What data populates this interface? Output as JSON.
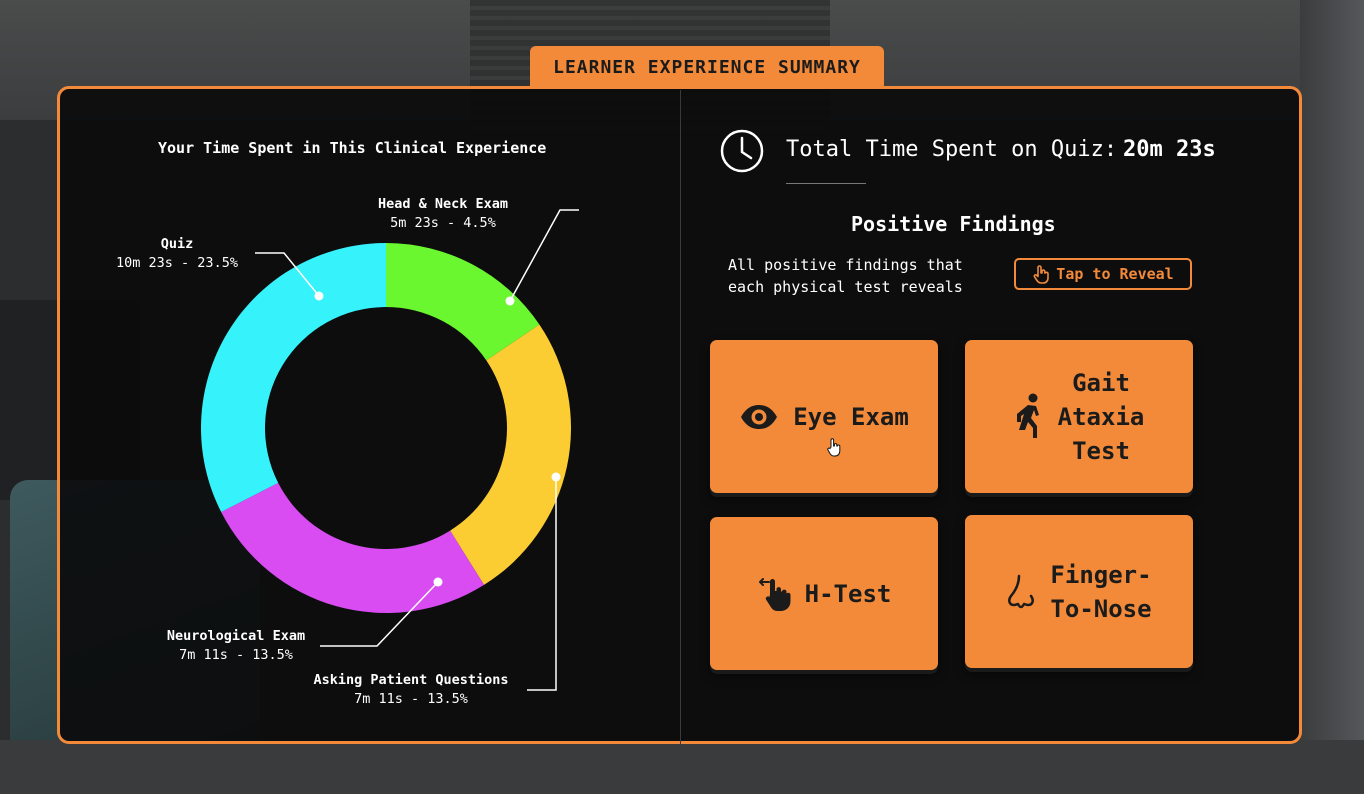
{
  "header": {
    "title": "LEARNER EXPERIENCE SUMMARY"
  },
  "time_chart": {
    "title": "Your Time Spent in This Clinical Experience",
    "segments": [
      {
        "name": "Head & Neck Exam",
        "value": "5m 23s - 4.5%",
        "color": "#6af72f"
      },
      {
        "name": "Asking Patient Questions",
        "value": "7m 11s - 13.5%",
        "color": "#fbcd33"
      },
      {
        "name": "Neurological Exam",
        "value": "7m 11s - 13.5%",
        "color": "#d84cf2"
      },
      {
        "name": "Quiz",
        "value": "10m 23s - 23.5%",
        "color": "#35f2fb"
      }
    ]
  },
  "total": {
    "label": "Total Time Spent on Quiz:",
    "value": "20m 23s",
    "icon": "clock-icon"
  },
  "findings": {
    "title": "Positive Findings",
    "description": "All positive findings that each physical test reveals",
    "reveal_button": "Tap to Reveal",
    "tests": [
      {
        "label": "Eye Exam",
        "icon": "eye-icon"
      },
      {
        "label": "Gait\nAtaxia\nTest",
        "icon": "walking-person-icon"
      },
      {
        "label": "H-Test",
        "icon": "hand-swipe-icon"
      },
      {
        "label": "Finger-\nTo-Nose",
        "icon": "nose-icon"
      }
    ]
  },
  "colors": {
    "accent": "#f28a3a",
    "panel": "#0a0a0b"
  }
}
